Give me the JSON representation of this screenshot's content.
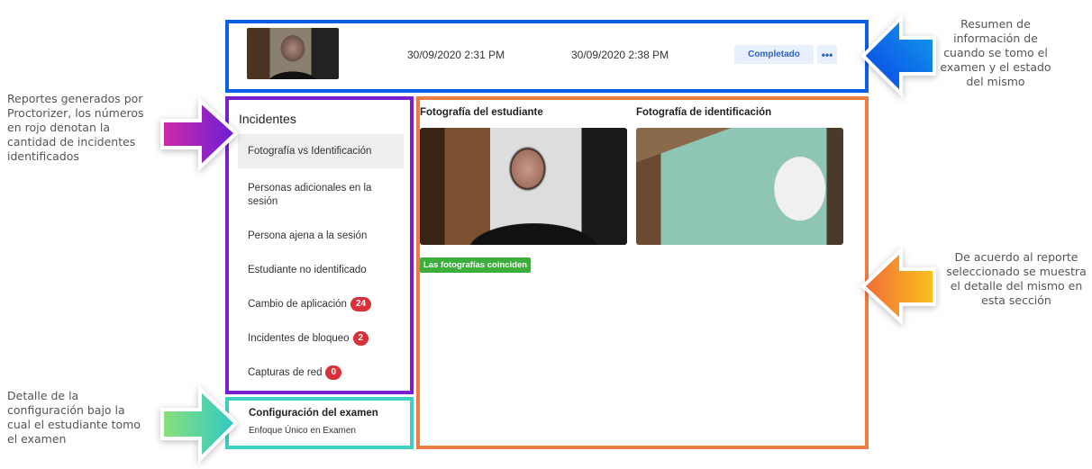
{
  "header": {
    "start": "30/09/2020 2:31 PM",
    "end": "30/09/2020 2:38 PM",
    "status": "Completado",
    "more": "•••"
  },
  "incidents": {
    "title": "Incidentes",
    "items": [
      {
        "label": "Fotografía vs Identificación",
        "selected": true
      },
      {
        "label": "Personas adicionales en la sesión"
      },
      {
        "label": "Persona ajena a la sesión"
      },
      {
        "label": "Estudiante no identificado"
      },
      {
        "label": "Cambio de aplicación",
        "count": "24"
      },
      {
        "label": "Incidentes de bloqueo",
        "count": "2"
      },
      {
        "label": "Capturas de red",
        "count": "0"
      }
    ]
  },
  "config": {
    "title": "Configuración del examen",
    "value": "Enfoque Único en Examen"
  },
  "detail": {
    "student_photo_title": "Fotografía del estudiante",
    "id_photo_title": "Fotografía de identificación",
    "result": "Las fotografías coinciden"
  },
  "notes": {
    "header": "Resumen de información de cuando se tomo el examen y el estado del mismo",
    "incidents": "Reportes generados por Proctorizer, los números en rojo denotan la cantidad de incidentes identificados",
    "config": "Detalle de la configuración bajo la cual el estudiante tomo el examen",
    "detail": "De acuerdo al reporte seleccionado se muestra el detalle del mismo en esta sección"
  },
  "colors": {
    "header": "#0b5ee8",
    "incidents": "#7a1fd0",
    "config": "#3fd0c2",
    "detail": "#ef7d42",
    "badge": "#d9303a",
    "success": "#3cae3c"
  }
}
